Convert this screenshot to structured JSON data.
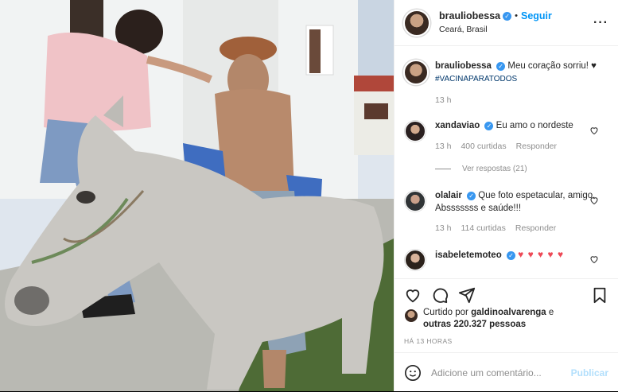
{
  "post": {
    "author": {
      "username": "brauliobessa",
      "verified": true,
      "follow_label": "Seguir",
      "location": "Ceará, Brasil",
      "more_icon": "more-options-icon"
    },
    "caption": {
      "username": "brauliobessa",
      "text": "Meu coração sorriu! ♥",
      "hashtag": "#VACINAPARATODOS",
      "time": "13 h"
    },
    "comments": [
      {
        "username": "xandaviao",
        "text": "Eu amo o nordeste",
        "time": "13 h",
        "likes": "400 curtidas",
        "reply": "Responder",
        "view_replies": "Ver respostas (21)"
      },
      {
        "username": "olalair",
        "text": "Que foto espetacular, amigo. Absssssss e saúde!!!",
        "time": "13 h",
        "likes": "114 curtidas",
        "reply": "Responder"
      },
      {
        "username": "isabeletemoteo",
        "text": "♥ ♥ ♥ ♥ ♥"
      }
    ],
    "liked_by": {
      "prefix": "Curtido por",
      "username": "galdinoalvarenga",
      "conjunction": "e",
      "others": "outras 220.327 pessoas"
    },
    "timestamp": "HÁ 13 HORAS",
    "composer": {
      "placeholder": "Adicione um comentário...",
      "publish_label": "Publicar"
    },
    "colors": {
      "accent": "#0095f6",
      "verified": "#3897f0",
      "heart": "#ed4956",
      "muted": "#8e8e8e"
    }
  }
}
